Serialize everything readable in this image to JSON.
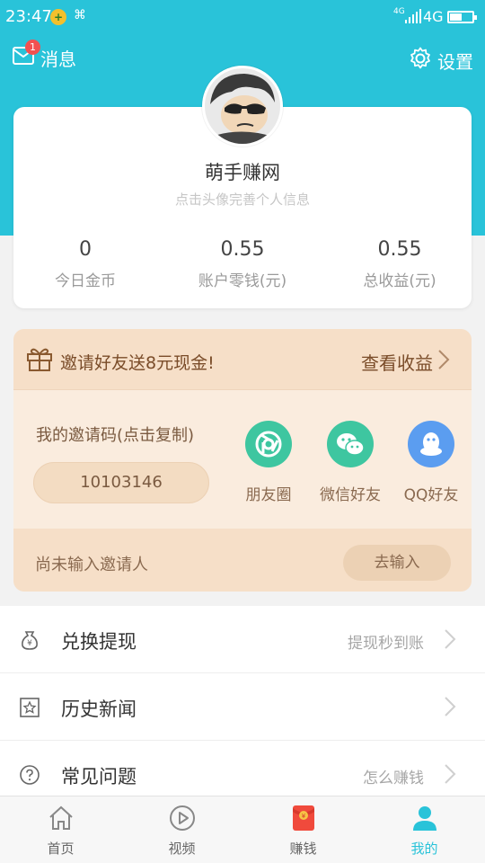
{
  "status_bar": {
    "time": "23:47",
    "network": "4G",
    "network_small": "4G"
  },
  "header": {
    "messages_label": "消息",
    "messages_badge": "1",
    "settings_label": "设置"
  },
  "profile": {
    "name": "萌手赚网",
    "hint": "点击头像完善个人信息",
    "stats": [
      {
        "value": "0",
        "label": "今日金币"
      },
      {
        "value": "0.55",
        "label": "账户零钱(元)"
      },
      {
        "value": "0.55",
        "label": "总收益(元)"
      }
    ]
  },
  "invite": {
    "title": "邀请好友送8元现金!",
    "view_earnings": "查看收益",
    "code_label": "我的邀请码(点击复制)",
    "code": "10103146",
    "share": [
      {
        "label": "朋友圈",
        "icon": "moments-icon",
        "color": "#3ec6a0"
      },
      {
        "label": "微信好友",
        "icon": "wechat-icon",
        "color": "#3ec6a0"
      },
      {
        "label": "QQ好友",
        "icon": "qq-icon",
        "color": "#5b9df0"
      }
    ],
    "no_inviter": "尚未输入邀请人",
    "go_input": "去输入"
  },
  "menu": [
    {
      "label": "兑换提现",
      "sub": "提现秒到账",
      "icon": "money-bag-icon"
    },
    {
      "label": "历史新闻",
      "sub": "",
      "icon": "star-document-icon"
    },
    {
      "label": "常见问题",
      "sub": "怎么赚钱",
      "icon": "question-icon"
    }
  ],
  "tabs": [
    {
      "label": "首页",
      "icon": "home-icon"
    },
    {
      "label": "视频",
      "icon": "play-icon"
    },
    {
      "label": "赚钱",
      "icon": "red-packet-icon"
    },
    {
      "label": "我的",
      "icon": "person-icon"
    }
  ],
  "colors": {
    "brand": "#29c3d9",
    "invite_bg": "#f8e7d6",
    "invite_text": "#7a4c29",
    "badge": "#f25151"
  }
}
